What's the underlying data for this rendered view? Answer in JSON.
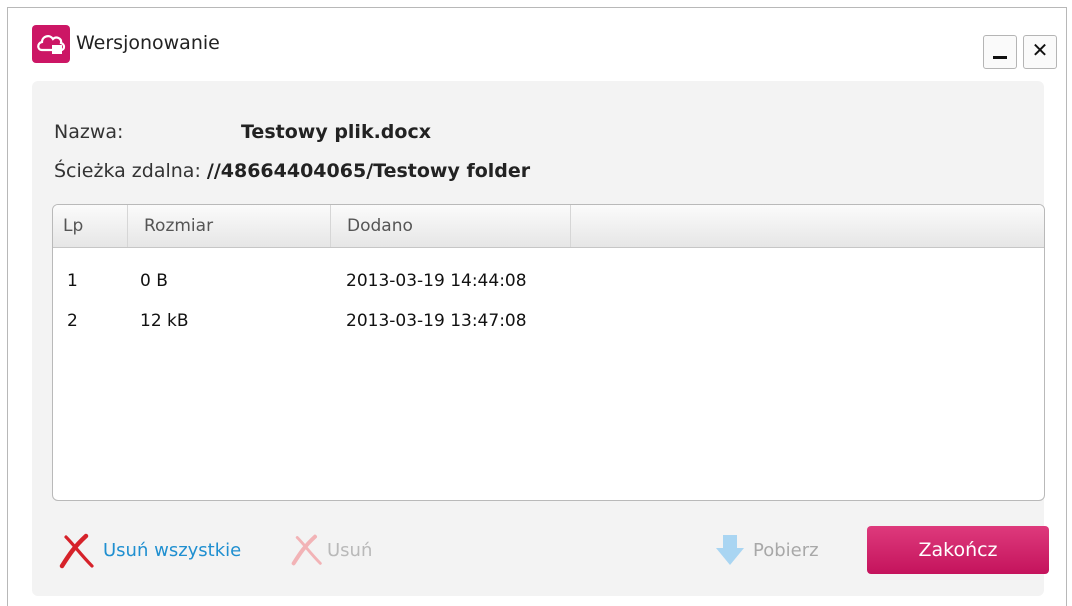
{
  "window": {
    "title": "Wersjonowanie",
    "accent_color": "#cc1665",
    "icons": {
      "app": "cloud-icon",
      "minimize": "minimize-icon",
      "close": "close-icon",
      "close_glyph": "✕"
    }
  },
  "file_info": {
    "name_label": "Nazwa:",
    "name_value": "Testowy plik.docx",
    "path_label": "Ścieżka zdalna:",
    "path_value": "//48664404065/Testowy folder"
  },
  "versions_table": {
    "headers": {
      "lp": "Lp",
      "size": "Rozmiar",
      "added": "Dodano"
    },
    "rows": [
      {
        "lp": "1",
        "size": "0 B",
        "added": "2013-03-19 14:44:08"
      },
      {
        "lp": "2",
        "size": "12 kB",
        "added": "2013-03-19 13:47:08"
      }
    ]
  },
  "actions": {
    "delete_all_label": "Usuń wszystkie",
    "delete_label": "Usuń",
    "download_label": "Pobierz",
    "finish_label": "Zakończ",
    "delete_icon": "red-x-icon",
    "download_icon": "download-arrow-icon"
  }
}
